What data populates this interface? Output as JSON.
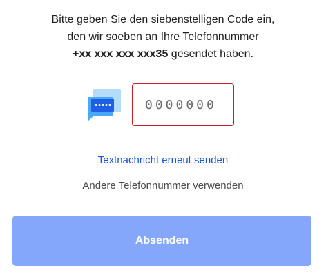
{
  "instructions": {
    "line1": "Bitte geben Sie den siebenstelligen Code ein,",
    "line2": "den wir soeben an Ihre Telefonnummer",
    "phone": "+xx xxx xxx xxx35",
    "line3_suffix": " gesendet haben."
  },
  "code_input": {
    "value": "",
    "placeholder": "0000000"
  },
  "icons": {
    "sms": "sms-message-icon"
  },
  "links": {
    "resend": "Textnachricht erneut senden",
    "other_phone": "Andere Telefonnummer verwenden"
  },
  "submit": {
    "label": "Absenden"
  },
  "colors": {
    "error_border": "#c0202a",
    "link": "#1a56db",
    "button_bg": "#85a7fb",
    "icon_light": "#b4dcfb",
    "icon_dark": "#1f5fe5"
  }
}
